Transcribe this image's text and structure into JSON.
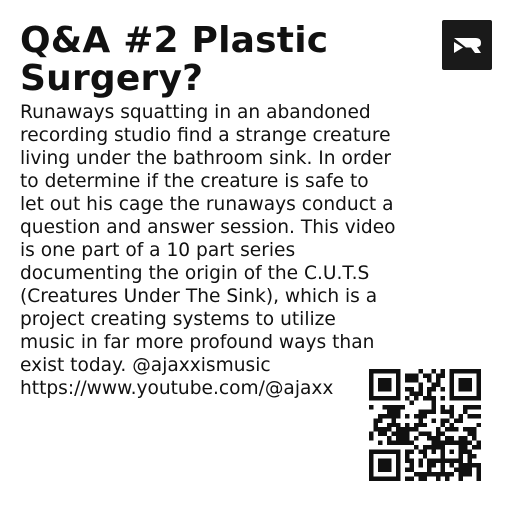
{
  "post": {
    "title": "Q&A #2 Plastic Surgery?",
    "description": "Runaways squatting in an abandoned\nrecording studio find a strange creature\nliving under the bathroom sink. In order\nto determine if the creature is safe to\nlet out his cage the runaways conduct a\nquestion and answer session.  This video\nis one part of a 10 part series\ndocumenting the origin of the C.U.T.S\n(Creatures Under The Sink), which is a\nproject creating systems to utilize\nmusic in far more profound ways than\nexist today.    @ajaxxismusic",
    "url_visible": "https://www.youtube.com/@ajaxx"
  },
  "brand": {
    "logo_icon": "brand-logo-icon",
    "logo_bg": "#1a1a1a",
    "logo_fg": "#ffffff"
  },
  "qr": {
    "icon": "qr-code-icon",
    "fg": "#111111",
    "bg": "#ffffff"
  },
  "colors": {
    "text": "#111111",
    "background": "#ffffff"
  }
}
